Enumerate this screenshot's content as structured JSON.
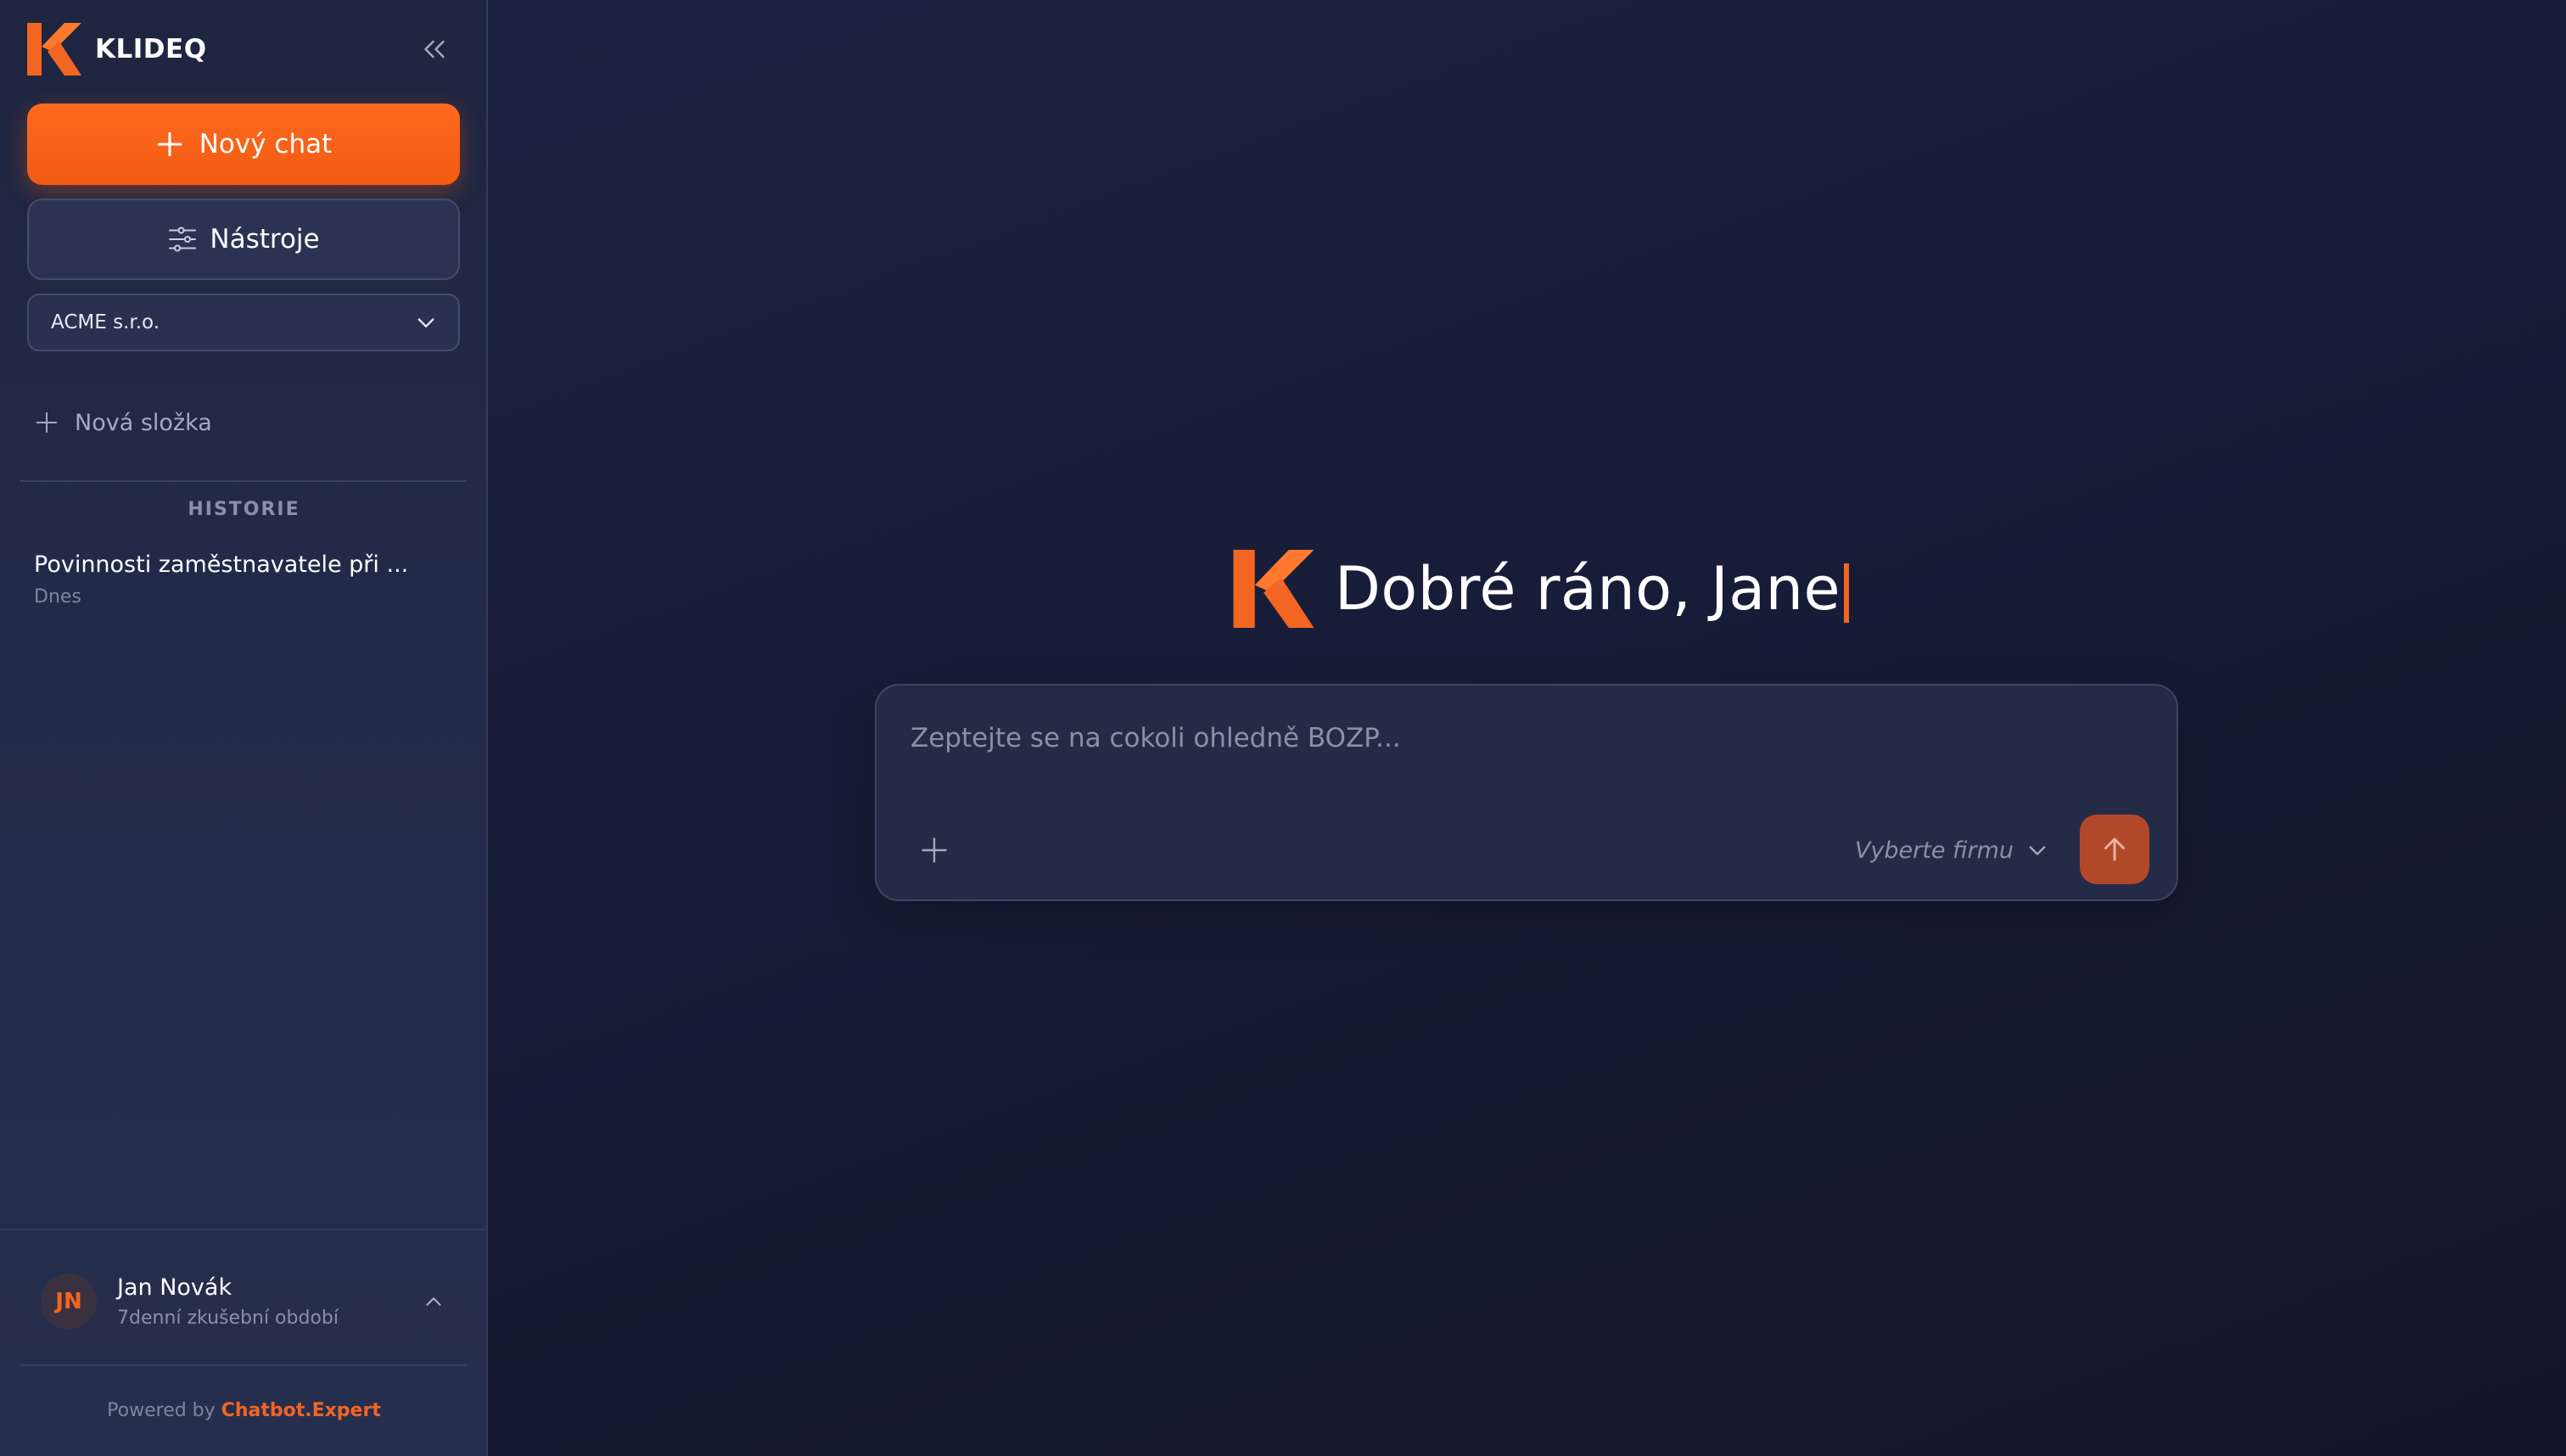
{
  "brand": {
    "name": "KLIDEQ",
    "accent": "#f26522"
  },
  "sidebar": {
    "collapse_icon": "chevrons-left-icon",
    "new_chat_label": "Nový chat",
    "tools_label": "Nástroje",
    "company_selected": "ACME s.r.o.",
    "new_folder_label": "Nová složka",
    "history": {
      "heading": "HISTORIE",
      "items": [
        {
          "title": "Povinnosti zaměstnavatele při ...",
          "date": "Dnes"
        }
      ]
    },
    "user": {
      "initials": "JN",
      "name": "Jan Novák",
      "plan": "7denní zkušební období"
    },
    "footer": {
      "powered_prefix": "Powered by",
      "powered_link": "Chatbot.Expert"
    }
  },
  "main": {
    "greeting": "Dobré ráno, Jane",
    "composer": {
      "placeholder": "Zeptejte se na cokoli ohledně BOZP...",
      "firm_select_label": "Vyberte firmu"
    }
  },
  "colors": {
    "accent": "#f26522",
    "sidebar_bg": "#1e2540",
    "main_bg": "#171d38",
    "send_button": "#b2482a"
  }
}
